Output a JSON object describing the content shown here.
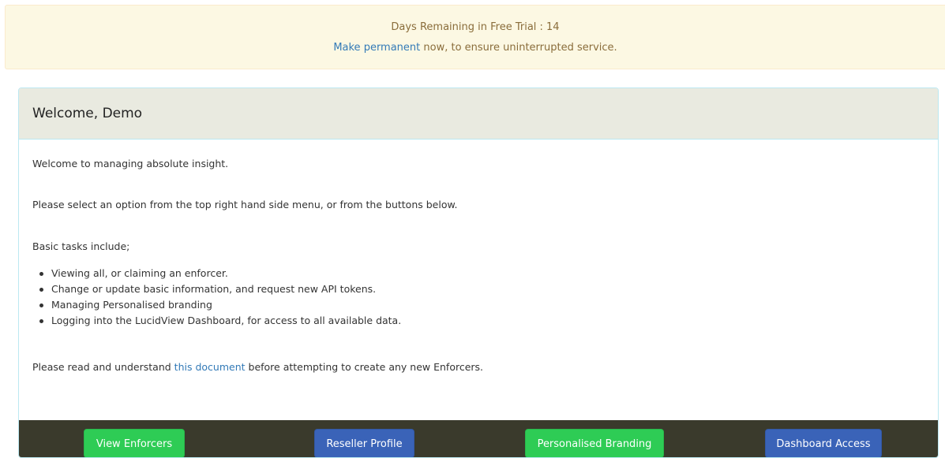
{
  "trial_banner": {
    "days_text": "Days Remaining in Free Trial : 14",
    "make_permanent_link": "Make permanent",
    "suffix_text": " now, to ensure uninterrupted service."
  },
  "panel": {
    "title": "Welcome, Demo",
    "intro": "Welcome to managing absolute insight.",
    "instruction": "Please select an option from the top right hand side menu, or from the buttons below.",
    "tasks_heading": "Basic tasks include;",
    "tasks": [
      "Viewing all, or claiming an enforcer.",
      "Change or update basic information, and request new API tokens.",
      "Managing Personalised branding",
      "Logging into the LucidView Dashboard, for access to all available data."
    ],
    "notice_prefix": "Please read and understand ",
    "notice_link": "this document",
    "notice_suffix": " before attempting to create any new Enforcers."
  },
  "footer_buttons": {
    "view_enforcers": "View Enforcers",
    "reseller_profile": "Reseller Profile",
    "personalised_branding": "Personalised Branding",
    "dashboard_access": "Dashboard Access"
  },
  "colors": {
    "banner_bg": "#fcf8e3",
    "banner_text": "#8a6d3b",
    "link": "#337ab7",
    "panel_heading_bg": "#e9eae0",
    "footer_bg": "#3a3a2c",
    "button_green": "#2ecc55",
    "button_blue": "#3a63b8"
  }
}
